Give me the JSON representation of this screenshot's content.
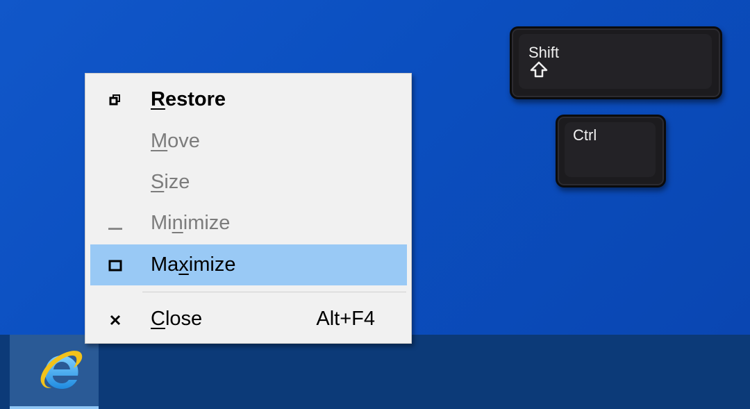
{
  "menu": {
    "items": [
      {
        "label_pre": "",
        "mnemonic": "R",
        "label_post": "estore",
        "icon": "restore-icon",
        "state": "enabled",
        "style": "bold"
      },
      {
        "label_pre": "",
        "mnemonic": "M",
        "label_post": "ove",
        "icon": "",
        "state": "disabled"
      },
      {
        "label_pre": "",
        "mnemonic": "S",
        "label_post": "ize",
        "icon": "",
        "state": "disabled"
      },
      {
        "label_pre": "Mi",
        "mnemonic": "n",
        "label_post": "imize",
        "icon": "minimize-icon",
        "state": "disabled"
      },
      {
        "label_pre": "Ma",
        "mnemonic": "x",
        "label_post": "imize",
        "icon": "maximize-icon",
        "state": "highlighted"
      },
      {
        "label_pre": "",
        "mnemonic": "C",
        "label_post": "lose",
        "icon": "close-icon",
        "state": "enabled",
        "shortcut": "Alt+F4"
      }
    ]
  },
  "keys": {
    "shift": {
      "label": "Shift",
      "icon": "shift-arrow-icon"
    },
    "ctrl": {
      "label": "Ctrl"
    }
  },
  "taskbar": {
    "pinned": [
      {
        "name": "internet-explorer",
        "icon": "ie-icon",
        "active": true
      }
    ]
  },
  "colors": {
    "desktop": "#0b4fc0",
    "taskbar": "#0c3a78",
    "menu_bg": "#f1f1f1",
    "highlight": "#99c9f5",
    "disabled_text": "#7c7c7c",
    "key": "#1c1b1e"
  }
}
